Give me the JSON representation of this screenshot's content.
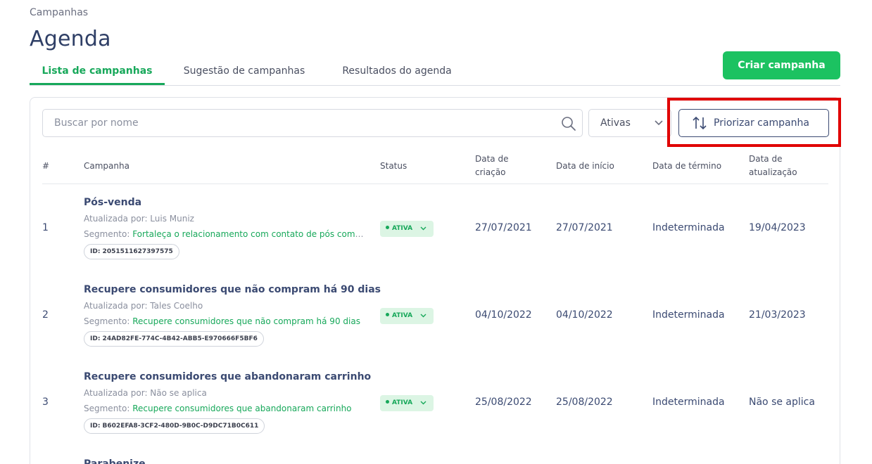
{
  "breadcrumb": "Campanhas",
  "page_title": "Agenda",
  "tabs": [
    {
      "label": "Lista de campanhas"
    },
    {
      "label": "Sugestão de campanhas"
    },
    {
      "label": "Resultados do agenda"
    }
  ],
  "create_button": "Criar campanha",
  "search": {
    "placeholder": "Buscar por nome"
  },
  "filter": {
    "selected": "Ativas"
  },
  "prioritize_button": "Priorizar campanha",
  "table": {
    "headers": {
      "num": "#",
      "campaign": "Campanha",
      "status": "Status",
      "created_1": "Data de",
      "created_2": "criação",
      "start": "Data de início",
      "end": "Data de término",
      "updated_1": "Data de",
      "updated_2": "atualização"
    },
    "rows": [
      {
        "num": "1",
        "name": "Pós-venda",
        "updated_by": "Atualizada por: Luis Muniz",
        "segment_label": "Segmento: ",
        "segment": "Fortaleça o relacionamento com contato de pós compra",
        "id": "ID: 2051511627397575",
        "status": "ATIVA",
        "created": "27/07/2021",
        "start": "27/07/2021",
        "end": "Indeterminada",
        "updated": "19/04/2023"
      },
      {
        "num": "2",
        "name": "Recupere consumidores que não compram há 90 dias",
        "updated_by": "Atualizada por: Tales Coelho",
        "segment_label": "Segmento: ",
        "segment": "Recupere consumidores que não compram há 90 dias",
        "id": "ID: 24AD82FE-774C-4B42-ABB5-E970666F5BF6",
        "status": "ATIVA",
        "created": "04/10/2022",
        "start": "04/10/2022",
        "end": "Indeterminada",
        "updated": "21/03/2023"
      },
      {
        "num": "3",
        "name": "Recupere consumidores que abandonaram carrinho",
        "updated_by": "Atualizada por: Não se aplica",
        "segment_label": "Segmento: ",
        "segment": "Recupere consumidores que abandonaram carrinho",
        "id": "ID: B602EFA8-3CF2-480D-9B0C-D9DC71B0C611",
        "status": "ATIVA",
        "created": "25/08/2022",
        "start": "25/08/2022",
        "end": "Indeterminada",
        "updated": "Não se aplica"
      },
      {
        "num": "",
        "name": "Parabenize",
        "updated_by": "",
        "segment_label": "",
        "segment": "",
        "id": "",
        "status": "",
        "created": "",
        "start": "",
        "end": "",
        "updated": ""
      }
    ]
  },
  "colors": {
    "accent": "#1cc261",
    "primary_text": "#3b4a72",
    "highlight": "#e00000",
    "status_bg": "#dcf5e4"
  }
}
